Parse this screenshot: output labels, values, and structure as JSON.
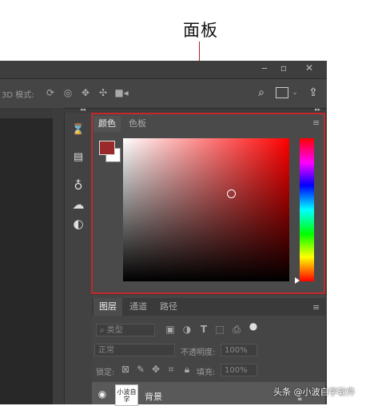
{
  "annotation": {
    "label": "面板"
  },
  "window": {
    "minimize": "‒",
    "maximize": "▫",
    "close": "✕"
  },
  "options_bar": {
    "mode_label": "3D 模式:"
  },
  "collapse": {
    "left": "◂◂",
    "right": "▸▸"
  },
  "color_panel": {
    "tabs": [
      "颜色",
      "色板"
    ],
    "active_tab": "颜色",
    "menu": "≡",
    "foreground_color": "#9a2a2a",
    "background_color": "#ffffff"
  },
  "layers_panel": {
    "tabs": [
      "图层",
      "通道",
      "路径"
    ],
    "active_tab": "图层",
    "menu": "≡",
    "filter_label": "类型",
    "blend_mode": "正常",
    "opacity_label": "不透明度:",
    "opacity_value": "100%",
    "lock_label": "锁定:",
    "fill_label": "填充:",
    "fill_value": "100%",
    "layer": {
      "name": "背景",
      "thumb_text": "小波自学"
    }
  },
  "watermark": "头条 @小波自学软件"
}
